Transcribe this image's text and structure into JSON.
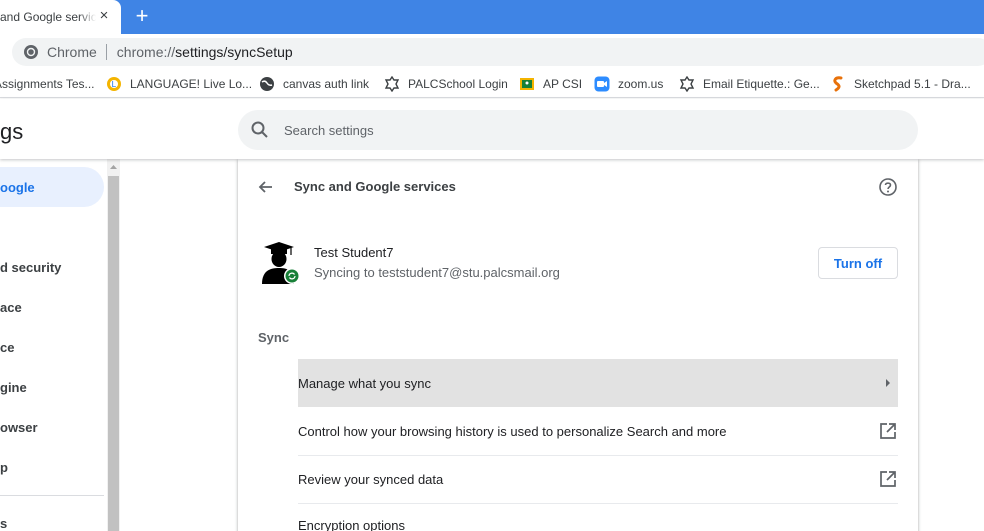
{
  "tab": {
    "title": "and Google servic",
    "close_glyph": "×",
    "new_tab_glyph": "+"
  },
  "omnibox": {
    "chip": "Chrome",
    "url_scheme": "chrome://",
    "url_path": "settings/syncSetup"
  },
  "bookmarks": [
    {
      "label": "Assignments Tes...",
      "icon": "document-icon"
    },
    {
      "label": "LANGUAGE! Live Lo...",
      "icon": "language-live-icon"
    },
    {
      "label": "canvas auth link",
      "icon": "globe-icon"
    },
    {
      "label": "PALCSchool Login",
      "icon": "puzzle-icon"
    },
    {
      "label": "AP CSI",
      "icon": "classroom-icon"
    },
    {
      "label": "zoom.us",
      "icon": "zoom-icon"
    },
    {
      "label": "Email Etiquette.: Ge...",
      "icon": "puzzle-icon"
    },
    {
      "label": "Sketchpad 5.1 - Dra...",
      "icon": "sketchpad-icon"
    }
  ],
  "header": {
    "title": "gs",
    "search_placeholder": "Search settings"
  },
  "sidebar": {
    "items": [
      {
        "label": "oogle",
        "active": true
      },
      {
        "label": "d security",
        "active": false
      },
      {
        "label": "ace",
        "active": false
      },
      {
        "label": "ce",
        "active": false
      },
      {
        "label": "gine",
        "active": false
      },
      {
        "label": "owser",
        "active": false
      },
      {
        "label": "p",
        "active": false
      },
      {
        "label": "s",
        "active": false
      }
    ]
  },
  "card": {
    "title": "Sync and Google services",
    "account": {
      "name": "Test Student7",
      "status": "Syncing to teststudent7@stu.palcsmail.org",
      "button": "Turn off"
    },
    "section_label": "Sync",
    "rows": [
      {
        "label": "Manage what you sync",
        "end_icon": "arrow-right-icon"
      },
      {
        "label": "Control how your browsing history is used to personalize Search and more",
        "end_icon": "open-in-new-icon"
      },
      {
        "label": "Review your synced data",
        "end_icon": "open-in-new-icon"
      },
      {
        "label": "Encryption options",
        "end_icon": ""
      }
    ]
  },
  "colors": {
    "tabstrip": "#3f84e5",
    "accent": "#1a73e8",
    "sync_badge": "#188038",
    "active_nav_bg": "#e8f0fe"
  }
}
